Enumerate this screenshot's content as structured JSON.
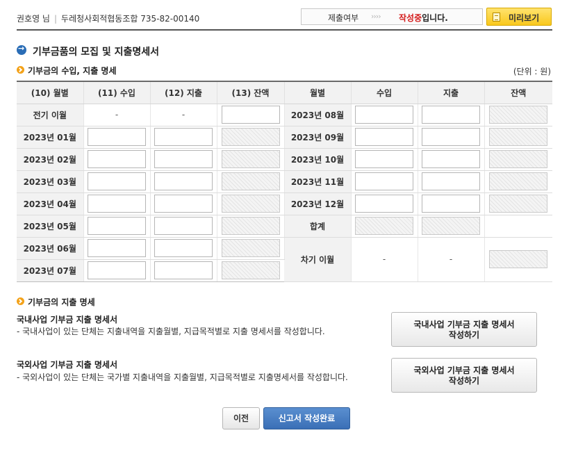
{
  "header": {
    "user_name": "권호영 님",
    "org": "두레청사회적협동조합 735-82-00140",
    "status_label": "제출여부",
    "status_arrows": "››››",
    "status_value_red": "작성중",
    "status_value_rest": "입니다.",
    "preview_label": "미리보기"
  },
  "page_title": "기부금품의 모집 및 지출명세서",
  "income_section": {
    "title": "기부금의 수입, 지출 명세",
    "unit": "(단위 : 원)",
    "headers": [
      "(10) 월별",
      "(11) 수입",
      "(12) 지출",
      "(13) 잔액",
      "월별",
      "수입",
      "지출",
      "잔액"
    ],
    "left_rows": [
      "전기 이월",
      "2023년 01월",
      "2023년 02월",
      "2023년 03월",
      "2023년 04월",
      "2023년 05월",
      "2023년 06월",
      "2023년 07월"
    ],
    "right_rows": [
      "2023년 08월",
      "2023년 09월",
      "2023년 10월",
      "2023년 11월",
      "2023년 12월",
      "합계",
      "차기 이월"
    ],
    "dash": "-"
  },
  "expense_section": {
    "title": "기부금의 지출 명세",
    "domestic": {
      "title": "국내사업 기부금 지출 명세서",
      "desc": "- 국내사업이 있는 단체는 지출내역을 지출월별, 지급목적별로 지출 명세서를 작성합니다.",
      "button_line1": "국내사업 기부금 지출 명세서",
      "button_line2": "작성하기"
    },
    "foreign": {
      "title": "국외사업 기부금 지출 명세서",
      "desc": "- 국외사업이 있는 단체는 국가별 지출내역을 지출월별, 지급목적별로 지출명세서를 작성합니다.",
      "button_line1": "국외사업 기부금 지출 명세서",
      "button_line2": "작성하기"
    }
  },
  "footer": {
    "prev_label": "이전",
    "submit_label": "신고서 작성완료"
  },
  "colors": {
    "accent_blue": "#3a6fb6",
    "status_red": "#d41b1b",
    "preview_yellow": "#f9c81c",
    "bullet_orange": "#f3a21a"
  }
}
